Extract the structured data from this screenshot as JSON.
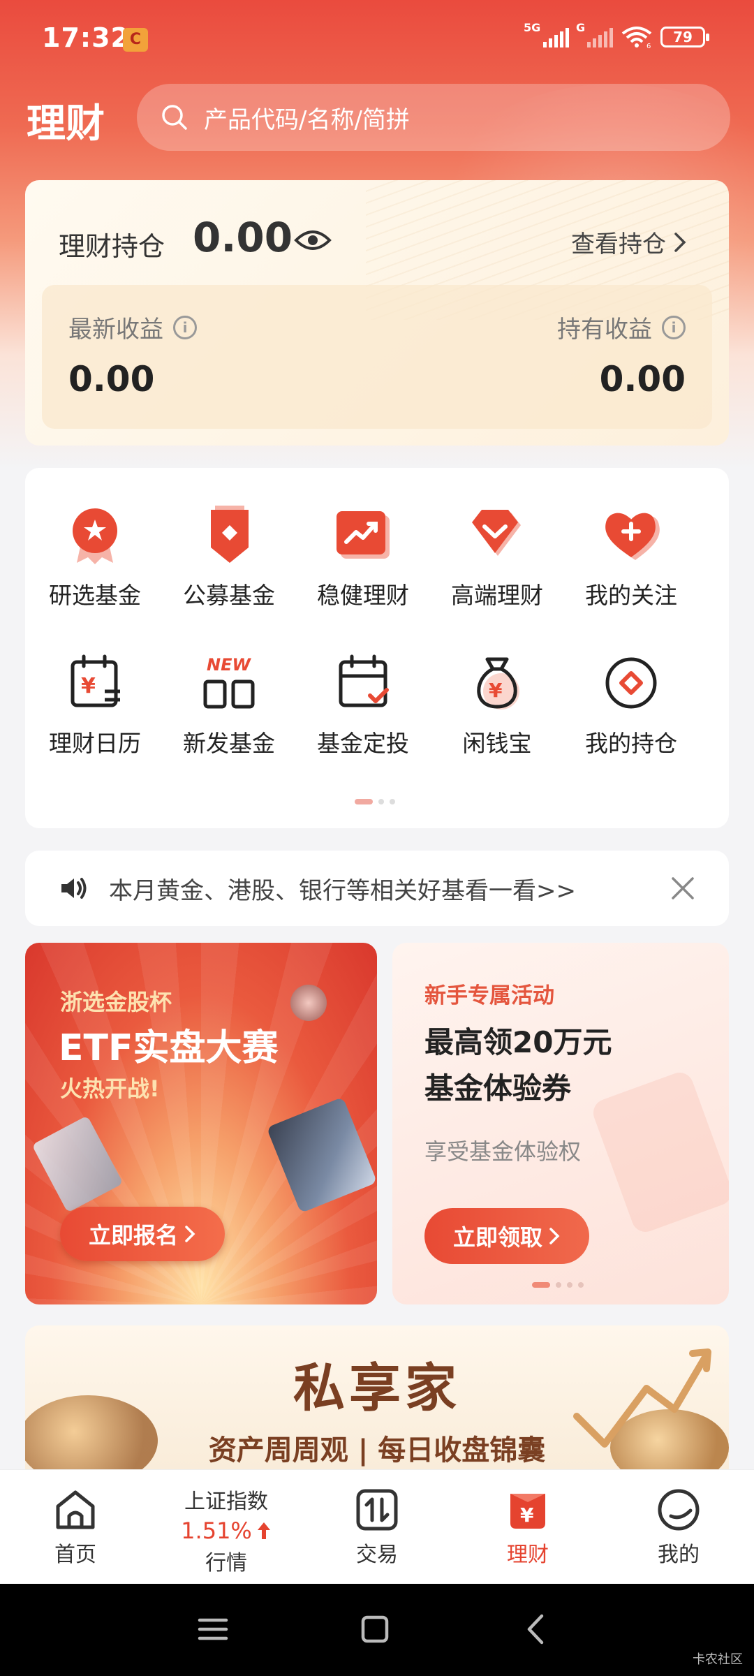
{
  "status_bar": {
    "time": "17:32",
    "app_icon_glyph": "C",
    "signal_1_label": "5G",
    "signal_2_label": "G",
    "wifi_badge": "6",
    "battery": "79"
  },
  "header": {
    "title": "理财",
    "search_placeholder": "产品代码/名称/简拼"
  },
  "holdings": {
    "label": "理财持仓",
    "value": "0.00",
    "view_link": "查看持仓",
    "latest_income_label": "最新收益",
    "latest_income_value": "0.00",
    "hold_income_label": "持有收益",
    "hold_income_value": "0.00"
  },
  "menu": {
    "items": [
      {
        "label": "研选基金",
        "icon": "ribbon-star-icon"
      },
      {
        "label": "公募基金",
        "icon": "shield-badge-icon"
      },
      {
        "label": "稳健理财",
        "icon": "trend-chart-icon"
      },
      {
        "label": "高端理财",
        "icon": "diamond-icon"
      },
      {
        "label": "我的关注",
        "icon": "heart-plus-icon"
      },
      {
        "label": "理财日历",
        "icon": "calendar-yuan-icon"
      },
      {
        "label": "新发基金",
        "icon": "new-fund-icon",
        "badge": "NEW"
      },
      {
        "label": "基金定投",
        "icon": "calendar-check-icon"
      },
      {
        "label": "闲钱宝",
        "icon": "money-bag-icon"
      },
      {
        "label": "我的持仓",
        "icon": "diamond-coin-icon"
      }
    ],
    "page_count": 3,
    "active_page": 1
  },
  "notice": {
    "text": "本月黄金、港股、银行等相关好基看一看>>"
  },
  "promo_left": {
    "subtitle": "浙选金股杯",
    "title": "ETF实盘大赛",
    "tagline": "火热开战!",
    "button": "立即报名"
  },
  "promo_right": {
    "subtitle": "新手专属活动",
    "title_line1": "最高领20万元",
    "title_line2": "基金体验券",
    "description": "享受基金体验权",
    "button": "立即领取"
  },
  "private_banner": {
    "title": "私享家",
    "subtitle": "资产周周观 | 每日收盘锦囊"
  },
  "bottom_nav": {
    "home": "首页",
    "index_name": "上证指数",
    "index_change": "1.51%",
    "market": "行情",
    "trade": "交易",
    "wealth": "理财",
    "wealth_icon_glyph": "¥",
    "mine": "我的"
  },
  "watermark": "卡农社区",
  "colors": {
    "brand_red": "#e5432f",
    "header_red": "#ea4b3e",
    "card_cream": "#fdf0dc"
  }
}
